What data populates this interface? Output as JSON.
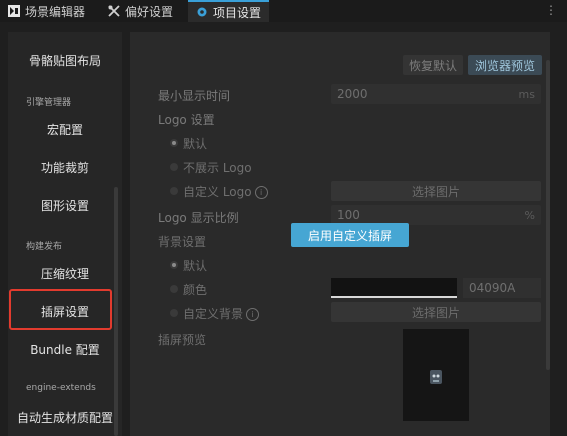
{
  "tabs": [
    {
      "label": "场景编辑器",
      "icon": "scene-icon",
      "active": false
    },
    {
      "label": "偏好设置",
      "icon": "tools-icon",
      "active": false
    },
    {
      "label": "项目设置",
      "icon": "gear-icon",
      "active": true
    }
  ],
  "menu_label": "⋮",
  "sidebar": {
    "items": [
      {
        "label": "骨骼贴图布局",
        "type": "item"
      },
      {
        "label": "引擎管理器",
        "type": "group"
      },
      {
        "label": "宏配置",
        "type": "item"
      },
      {
        "label": "功能裁剪",
        "type": "item"
      },
      {
        "label": "图形设置",
        "type": "item"
      },
      {
        "label": "构建发布",
        "type": "group"
      },
      {
        "label": "压缩纹理",
        "type": "item"
      },
      {
        "label": "插屏设置",
        "type": "item",
        "selected": true
      },
      {
        "label": "Bundle 配置",
        "type": "item"
      },
      {
        "label": "engine-extends",
        "type": "group"
      },
      {
        "label": "自动生成材质配置",
        "type": "item"
      }
    ]
  },
  "main": {
    "restore_default": "恢复默认",
    "browser_preview": "浏览器预览",
    "min_display_time_label": "最小显示时间",
    "min_display_time_value": "2000",
    "min_display_time_unit": "ms",
    "logo_settings_label": "Logo 设置",
    "logo_default": "默认",
    "logo_hide": "不展示 Logo",
    "logo_custom": "自定义 Logo",
    "select_image": "选择图片",
    "logo_ratio_label": "Logo 显示比例",
    "logo_ratio_value": "100",
    "logo_ratio_unit": "%",
    "bg_settings_label": "背景设置",
    "bg_default": "默认",
    "bg_color": "颜色",
    "bg_color_hex": "04090A",
    "bg_custom": "自定义背景",
    "select_image_2": "选择图片",
    "splash_preview_label": "插屏预览",
    "enable_custom_splash": "启用自定义插屏"
  },
  "colors": {
    "accent": "#46a6d3",
    "highlight_border": "#e23b2e",
    "bg_swatch": "#121212"
  }
}
